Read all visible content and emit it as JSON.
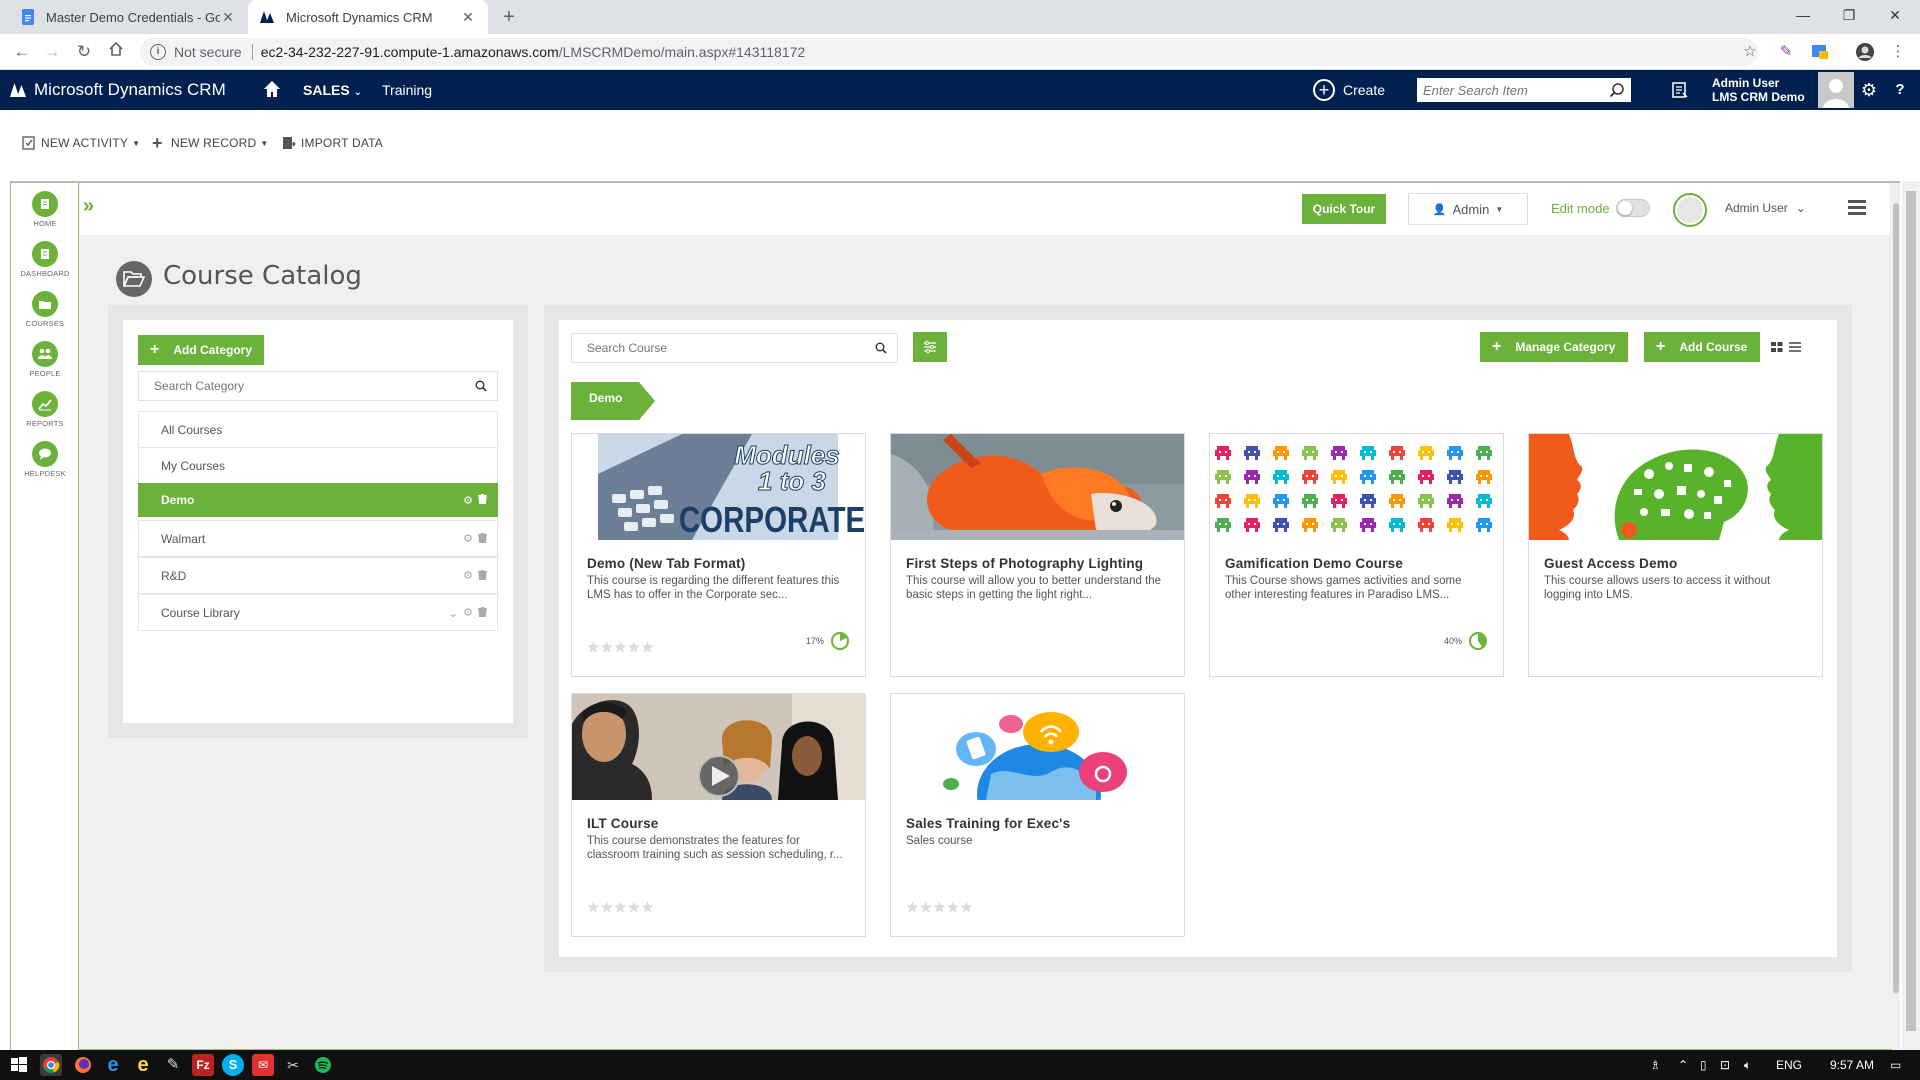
{
  "browser": {
    "tabs": [
      {
        "title": "Master Demo Credentials - Goog",
        "active": false
      },
      {
        "title": "Microsoft Dynamics CRM",
        "active": true
      }
    ],
    "security_label": "Not secure",
    "url_host": "ec2-34-232-227-91.compute-1.amazonaws.com",
    "url_path": "/LMSCRMDemo/main.aspx#143118172"
  },
  "crm": {
    "brand": "Microsoft Dynamics CRM",
    "module": "SALES",
    "area": "Training",
    "create_label": "Create",
    "search_placeholder": "Enter Search Item",
    "user_name": "Admin User",
    "org_name": "LMS CRM Demo"
  },
  "commands": {
    "new_activity": "NEW ACTIVITY",
    "new_record": "NEW RECORD",
    "import_data": "IMPORT DATA"
  },
  "lms_nav": [
    {
      "label": "HOME",
      "icon": "home-icon"
    },
    {
      "label": "DASHBOARD",
      "icon": "dashboard-icon"
    },
    {
      "label": "COURSES",
      "icon": "courses-icon"
    },
    {
      "label": "PEOPLE",
      "icon": "people-icon"
    },
    {
      "label": "REPORTS",
      "icon": "reports-icon"
    },
    {
      "label": "HELPDESK",
      "icon": "helpdesk-icon"
    }
  ],
  "topbar": {
    "quick_tour": "Quick Tour",
    "role": "Admin",
    "edit_mode": "Edit mode",
    "user": "Admin User"
  },
  "page_title": "Course Catalog",
  "categories_panel": {
    "add_label": "Add Category",
    "search_placeholder": "Search Category",
    "items": [
      {
        "name": "All Courses",
        "active": false,
        "tools": false
      },
      {
        "name": "My Courses",
        "active": false,
        "tools": false
      },
      {
        "name": "Demo",
        "active": true,
        "tools": true
      },
      {
        "name": "Walmart",
        "active": false,
        "tools": true
      },
      {
        "name": "R&D",
        "active": false,
        "tools": true
      },
      {
        "name": "Course Library",
        "active": false,
        "tools": true,
        "expandable": true
      }
    ]
  },
  "courses_panel": {
    "search_placeholder": "Search Course",
    "manage_label": "Manage Category",
    "add_label": "Add Course",
    "breadcrumb": "Demo"
  },
  "courses": [
    {
      "title": "Demo (New Tab Format)",
      "desc": "This course is regarding the different features this LMS has to offer in the Corporate sec...",
      "rating": 0,
      "progress": "17%"
    },
    {
      "title": "First Steps of Photography Lighting",
      "desc": "This course will allow you to better understand the basic steps in getting the light right...",
      "rating": null,
      "progress": null
    },
    {
      "title": "Gamification Demo Course",
      "desc": "This Course shows games activities and some other interesting features in Paradiso LMS...",
      "rating": null,
      "progress": "40%"
    },
    {
      "title": "Guest Access Demo",
      "desc": "This course allows users to access it without logging into LMS.",
      "rating": null,
      "progress": null
    },
    {
      "title": "ILT Course",
      "desc": "This course demonstrates the features for classroom training such as session scheduling, r...",
      "rating": 0,
      "progress": null
    },
    {
      "title": "Sales Training for Exec's",
      "desc": "Sales course",
      "rating": 0,
      "progress": null
    }
  ],
  "thumb_text": {
    "line1": "Modules",
    "line2": "1 to 3",
    "line3": "CORPORATE"
  },
  "taskbar": {
    "lang": "ENG",
    "time": "9:57 AM"
  },
  "colors": {
    "accent": "#6bb13a",
    "crm_nav": "#002050"
  }
}
